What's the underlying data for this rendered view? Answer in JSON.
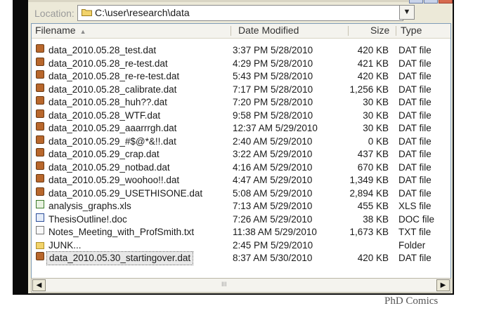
{
  "location": {
    "label": "Location:",
    "path": "C:\\user\\research\\data",
    "dropdown_icon": "chevron-down-icon"
  },
  "columns": {
    "name": "Filename",
    "date": "Date Modified",
    "size": "Size",
    "type": "Type"
  },
  "files": [
    {
      "icon": "dat",
      "name": "data_2010.05.28_test.dat",
      "modified": "3:37 PM  5/28/2010",
      "size": "420 KB",
      "type": "DAT file"
    },
    {
      "icon": "dat",
      "name": "data_2010.05.28_re-test.dat",
      "modified": "4:29 PM  5/28/2010",
      "size": "421 KB",
      "type": "DAT file"
    },
    {
      "icon": "dat",
      "name": "data_2010.05.28_re-re-test.dat",
      "modified": "5:43 PM  5/28/2010",
      "size": "420 KB",
      "type": "DAT file"
    },
    {
      "icon": "dat",
      "name": "data_2010.05.28_calibrate.dat",
      "modified": "7:17 PM  5/28/2010",
      "size": "1,256 KB",
      "type": "DAT file"
    },
    {
      "icon": "dat",
      "name": "data_2010.05.28_huh??.dat",
      "modified": "7:20 PM  5/28/2010",
      "size": "30 KB",
      "type": "DAT file"
    },
    {
      "icon": "dat",
      "name": "data_2010.05.28_WTF.dat",
      "modified": "9:58 PM  5/28/2010",
      "size": "30 KB",
      "type": "DAT file"
    },
    {
      "icon": "dat",
      "name": "data_2010.05.29_aaarrrgh.dat",
      "modified": "12:37 AM  5/29/2010",
      "size": "30 KB",
      "type": "DAT file"
    },
    {
      "icon": "dat",
      "name": "data_2010.05.29_#$@*&!!.dat",
      "modified": "2:40 AM  5/29/2010",
      "size": "0 KB",
      "type": "DAT file"
    },
    {
      "icon": "dat",
      "name": "data_2010.05.29_crap.dat",
      "modified": "3:22 AM  5/29/2010",
      "size": "437 KB",
      "type": "DAT file"
    },
    {
      "icon": "dat",
      "name": "data_2010.05.29_notbad.dat",
      "modified": "4:16 AM  5/29/2010",
      "size": "670 KB",
      "type": "DAT file"
    },
    {
      "icon": "dat",
      "name": "data_2010.05.29_woohoo!!.dat",
      "modified": "4:47 AM  5/29/2010",
      "size": "1,349 KB",
      "type": "DAT file"
    },
    {
      "icon": "dat",
      "name": "data_2010.05.29_USETHISONE.dat",
      "modified": "5:08 AM  5/29/2010",
      "size": "2,894 KB",
      "type": "DAT file"
    },
    {
      "icon": "xls",
      "name": "analysis_graphs.xls",
      "modified": "7:13 AM  5/29/2010",
      "size": "455 KB",
      "type": "XLS file"
    },
    {
      "icon": "doc",
      "name": "ThesisOutline!.doc",
      "modified": "7:26 AM  5/29/2010",
      "size": "38 KB",
      "type": "DOC file"
    },
    {
      "icon": "txt",
      "name": "Notes_Meeting_with_ProfSmith.txt",
      "modified": "11:38 AM  5/29/2010",
      "size": "1,673 KB",
      "type": "TXT file"
    },
    {
      "icon": "folder",
      "name": "JUNK...",
      "modified": "2:45 PM  5/29/2010",
      "size": "",
      "type": "Folder"
    },
    {
      "icon": "dat",
      "name": "data_2010.05.30_startingover.dat",
      "modified": "8:37 AM  5/30/2010",
      "size": "420 KB",
      "type": "DAT file",
      "selected": true
    }
  ],
  "scrollbar": {
    "left_arrow": "◀",
    "right_arrow": "▶",
    "grip": "III"
  },
  "credit": "PhD Comics",
  "colors": {
    "frame": "#0a0a0a",
    "window": "#ece9d8",
    "list_border": "#7f9db9",
    "dat_icon": "#b8672c"
  }
}
